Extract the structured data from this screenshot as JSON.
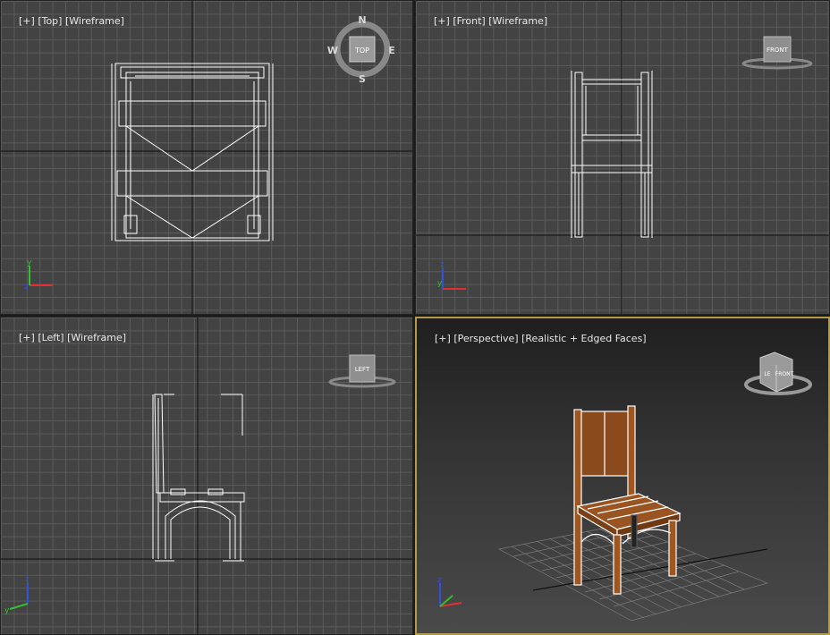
{
  "viewports": {
    "top": {
      "menu": "[+]",
      "view": "[Top]",
      "shading": "[Wireframe]"
    },
    "front": {
      "menu": "[+]",
      "view": "[Front]",
      "shading": "[Wireframe]"
    },
    "left": {
      "menu": "[+]",
      "view": "[Left]",
      "shading": "[Wireframe]"
    },
    "perspective": {
      "menu": "[+]",
      "view": "[Perspective]",
      "shading": "[Realistic + Edged Faces]"
    }
  },
  "viewcube": {
    "top_face": "TOP",
    "front_face": "FRONT",
    "left_face": "LEFT",
    "persp_faces": [
      "LE",
      "FRONT"
    ],
    "compass": {
      "n": "N",
      "s": "S",
      "e": "E",
      "w": "W"
    }
  },
  "axis_labels": {
    "x": "x",
    "y": "y",
    "z": "z"
  },
  "colors": {
    "viewport_bg": "#434343",
    "grid_line": "#5a5a5a",
    "wire": "#ffffff",
    "active_border": "#b49a4e",
    "wood": "#8a4a1c",
    "axis_x": "#e03030",
    "axis_y": "#30c030",
    "axis_z": "#3050e0"
  }
}
